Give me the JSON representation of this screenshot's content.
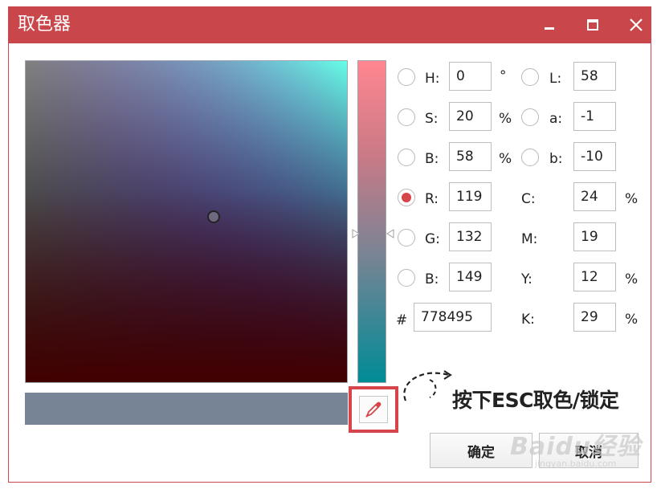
{
  "window": {
    "title": "取色器"
  },
  "colors": {
    "accent": "#c9474b",
    "preview": "#778495"
  },
  "fields": {
    "H": {
      "label": "H:",
      "value": "0",
      "unit": "°"
    },
    "S": {
      "label": "S:",
      "value": "20",
      "unit": "%"
    },
    "Bv": {
      "label": "B:",
      "value": "58",
      "unit": "%"
    },
    "R": {
      "label": "R:",
      "value": "119"
    },
    "G": {
      "label": "G:",
      "value": "132"
    },
    "Bc": {
      "label": "B:",
      "value": "149"
    },
    "hex": {
      "label": "#",
      "value": "778495"
    },
    "L": {
      "label": "L:",
      "value": "58"
    },
    "a": {
      "label": "a:",
      "value": "-1"
    },
    "b": {
      "label": "b:",
      "value": "-10"
    },
    "C": {
      "label": "C:",
      "value": "24",
      "unit": "%"
    },
    "M": {
      "label": "M:",
      "value": "19"
    },
    "Y": {
      "label": "Y:",
      "value": "12",
      "unit": "%"
    },
    "K": {
      "label": "K:",
      "value": "29",
      "unit": "%"
    }
  },
  "selected_mode": "R",
  "hint": "按下ESC取色/锁定",
  "buttons": {
    "ok": "确定",
    "cancel": "取消"
  },
  "watermark": {
    "main": "Baidu经验",
    "sub": "jingyan.baidu.com"
  },
  "icons": {
    "minimize": "minimize-icon",
    "maximize": "maximize-icon",
    "close": "close-icon",
    "eyedropper": "eyedropper-icon",
    "arrow": "curved-arrow-icon"
  }
}
